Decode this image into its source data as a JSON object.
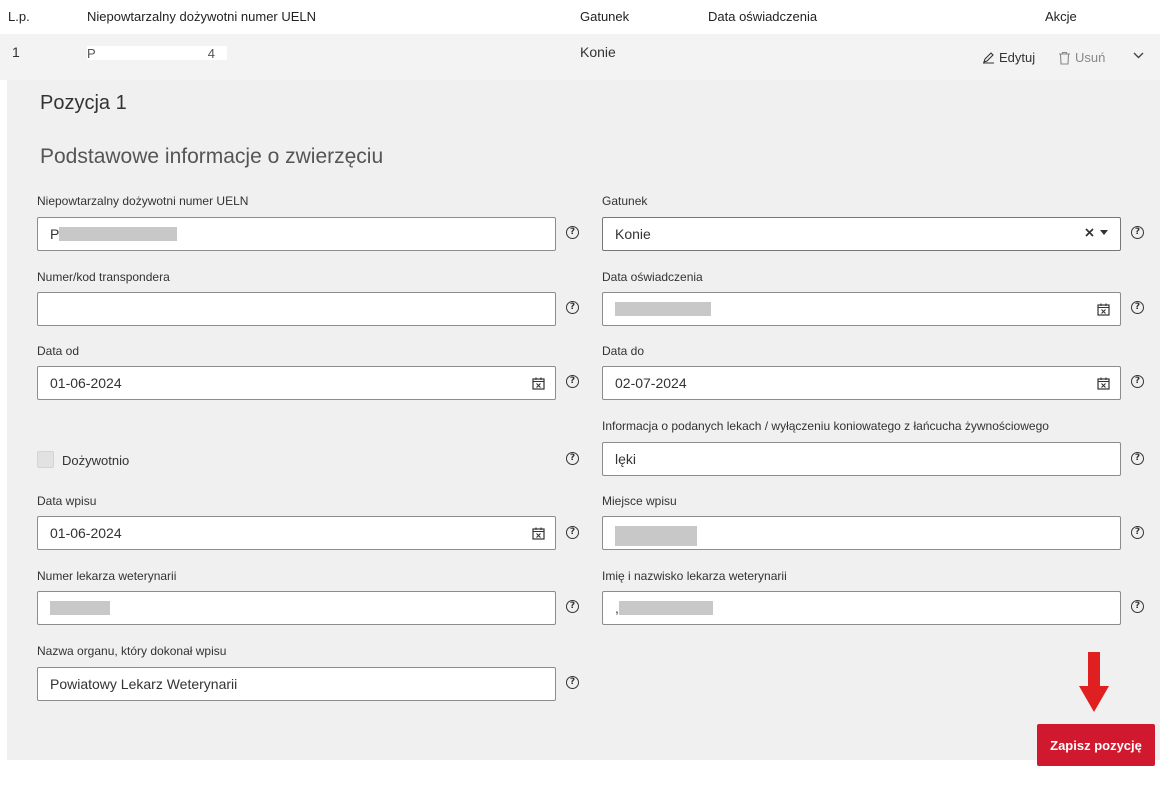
{
  "table": {
    "headers": [
      "L.p.",
      "Niepowtarzalny dożywotni numer UELN",
      "Gatunek",
      "Data oświadczenia",
      "Akcje"
    ],
    "row": {
      "lp": "1",
      "ueln_first": "P",
      "ueln_last": "4",
      "gatunek": "Konie",
      "edit_label": "Edytuj",
      "delete_label": "Usuń"
    }
  },
  "panel": {
    "position_title": "Pozycja 1",
    "section_title": "Podstawowe informacje o zwierzęciu"
  },
  "form": {
    "ueln_label": "Niepowtarzalny dożywotni numer UELN",
    "ueln_value": "P",
    "gatunek_label": "Gatunek",
    "gatunek_value": "Konie",
    "transponder_label": "Numer/kod transpondera",
    "transponder_value": "",
    "data_osw_label": "Data oświadczenia",
    "data_osw_value": "",
    "data_od_label": "Data od",
    "data_od_value": "01-06-2024",
    "data_do_label": "Data do",
    "data_do_value": "02-07-2024",
    "leki_label": "Informacja o podanych lekach / wyłączeniu koniowatego z łańcucha żywnościowego",
    "leki_value": "lęki",
    "dozywotnio_label": "Dożywotnio",
    "data_wpisu_label": "Data wpisu",
    "data_wpisu_value": "01-06-2024",
    "miejsce_label": "Miejsce wpisu",
    "numer_lek_label": "Numer lekarza weterynarii",
    "imie_lek_label": "Imię i nazwisko lekarza weterynarii",
    "imie_lek_value": ",",
    "organ_label": "Nazwa organu, który dokonał wpisu",
    "organ_value": "Powiatowy Lekarz Weterynarii"
  },
  "save_button": "Zapisz pozycję",
  "help_glyph": "?",
  "colors": {
    "primary_red": "#d0182f",
    "panel_bg": "#f0f0f0",
    "row_bg": "#f3f3f3"
  },
  "icons": [
    "pencil-icon",
    "trash-icon",
    "chevron-down-icon",
    "calendar-icon",
    "help-icon",
    "clear-icon",
    "caret-down-icon",
    "arrow-down-icon"
  ]
}
